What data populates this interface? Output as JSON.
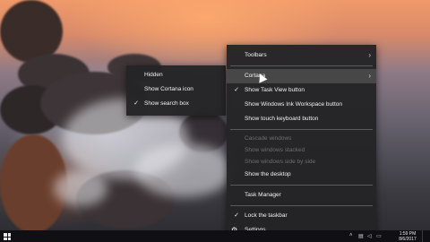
{
  "cortana_submenu": {
    "items": [
      {
        "label": "Hidden",
        "checked": false
      },
      {
        "label": "Show Cortana icon",
        "checked": false
      },
      {
        "label": "Show search box",
        "checked": true
      }
    ]
  },
  "taskbar_menu": {
    "toolbars": "Toolbars",
    "cortana": "Cortana",
    "show_task_view": "Show Task View button",
    "show_ink_workspace": "Show Windows Ink Workspace button",
    "show_touch_keyboard": "Show touch keyboard button",
    "cascade_windows": "Cascade windows",
    "show_windows_stacked": "Show windows stacked",
    "show_windows_side_by_side": "Show windows side by side",
    "show_desktop": "Show the desktop",
    "task_manager": "Task Manager",
    "lock_taskbar": "Lock the taskbar",
    "settings": "Settings"
  },
  "icons": {
    "check": "✓",
    "chevron": "›",
    "gear": "⚙"
  },
  "taskbar": {
    "time": "1:59 PM",
    "date": "8/6/2017"
  }
}
